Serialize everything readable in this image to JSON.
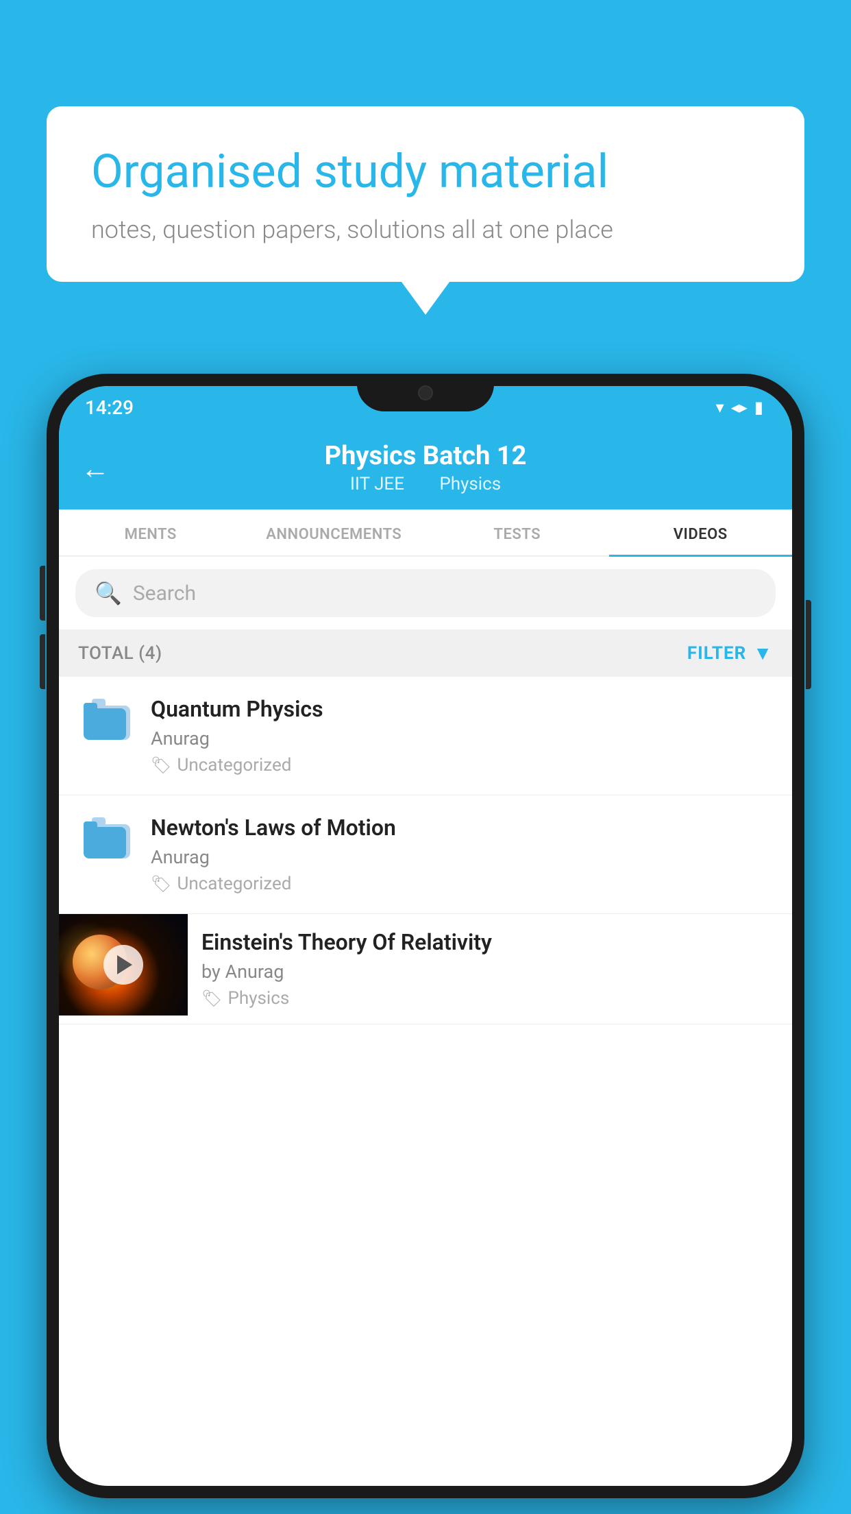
{
  "background_color": "#29b6e8",
  "speech_bubble": {
    "heading": "Organised study material",
    "subtext": "notes, question papers, solutions all at one place"
  },
  "phone": {
    "status_bar": {
      "time": "14:29",
      "wifi": "▾",
      "signal": "▲",
      "battery": "▮"
    },
    "header": {
      "title": "Physics Batch 12",
      "subtitle_part1": "IIT JEE",
      "subtitle_part2": "Physics",
      "back_label": "←"
    },
    "tabs": [
      {
        "label": "MENTS",
        "active": false
      },
      {
        "label": "ANNOUNCEMENTS",
        "active": false
      },
      {
        "label": "TESTS",
        "active": false
      },
      {
        "label": "VIDEOS",
        "active": true
      }
    ],
    "search": {
      "placeholder": "Search"
    },
    "filter_row": {
      "total_label": "TOTAL (4)",
      "filter_label": "FILTER"
    },
    "items": [
      {
        "id": 1,
        "title": "Quantum Physics",
        "author": "Anurag",
        "tag": "Uncategorized",
        "type": "folder"
      },
      {
        "id": 2,
        "title": "Newton's Laws of Motion",
        "author": "Anurag",
        "tag": "Uncategorized",
        "type": "folder"
      },
      {
        "id": 3,
        "title": "Einstein's Theory Of Relativity",
        "author": "by Anurag",
        "tag": "Physics",
        "type": "video"
      }
    ]
  }
}
